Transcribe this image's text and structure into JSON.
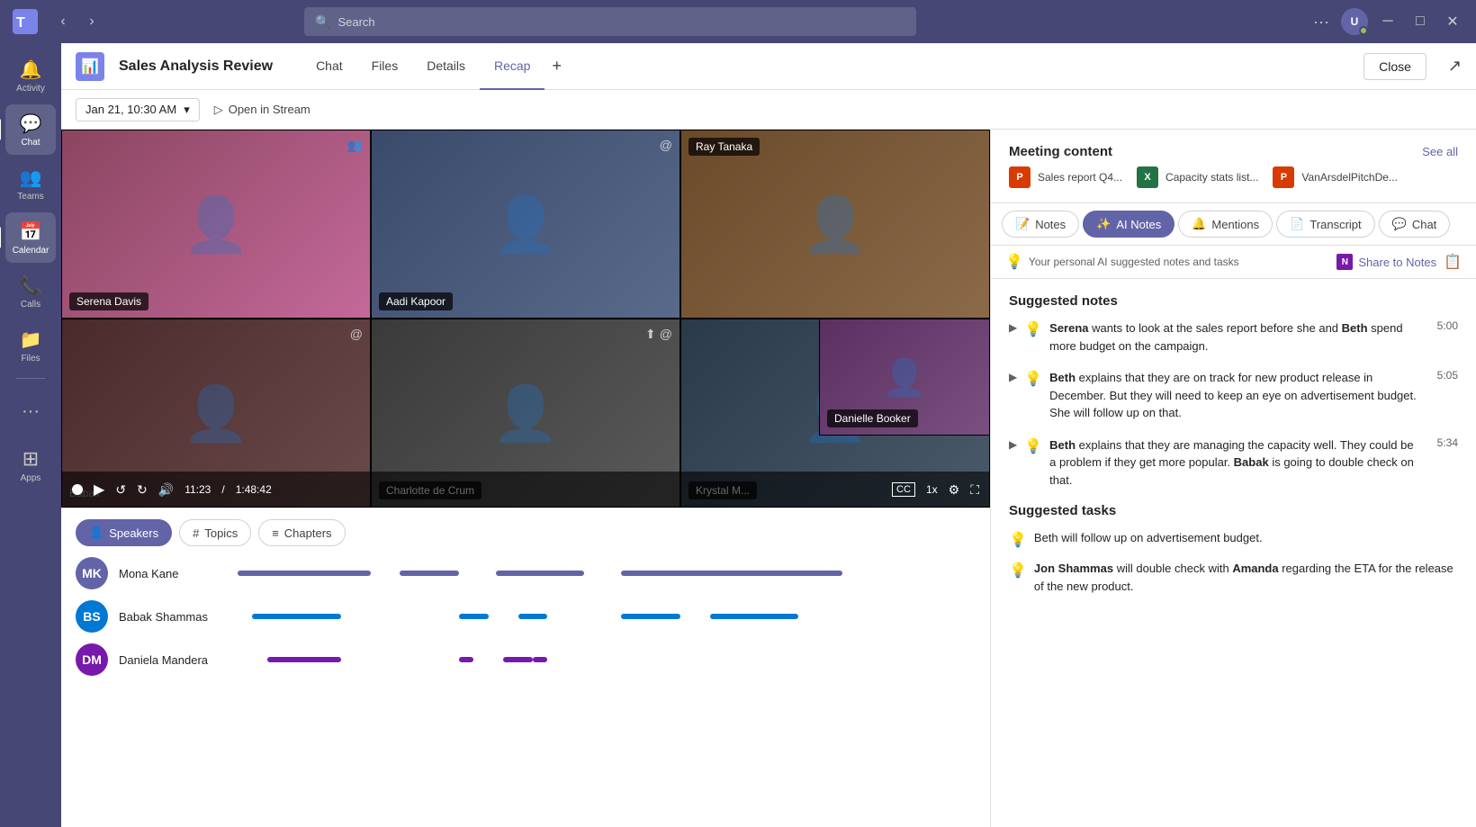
{
  "titlebar": {
    "search_placeholder": "Search",
    "ellipsis": "···",
    "user_initials": "U"
  },
  "sidebar": {
    "items": [
      {
        "id": "activity",
        "label": "Activity",
        "icon": "🔔"
      },
      {
        "id": "chat",
        "label": "Chat",
        "icon": "💬"
      },
      {
        "id": "teams",
        "label": "Teams",
        "icon": "👥"
      },
      {
        "id": "calendar",
        "label": "Calendar",
        "icon": "📅"
      },
      {
        "id": "calls",
        "label": "Calls",
        "icon": "📞"
      },
      {
        "id": "files",
        "label": "Files",
        "icon": "📁"
      },
      {
        "id": "more",
        "label": "···",
        "icon": "···"
      },
      {
        "id": "apps",
        "label": "Apps",
        "icon": "+"
      }
    ]
  },
  "meeting": {
    "title": "Sales Analysis Review",
    "tabs": [
      "Chat",
      "Files",
      "Details",
      "Recap"
    ],
    "active_tab": "Recap",
    "add_tab_label": "+",
    "close_label": "Close",
    "date_time": "Jan 21, 10:30 AM",
    "open_stream_label": "Open in Stream"
  },
  "video": {
    "participants": [
      {
        "name": "Serena Davis",
        "position": "bottom-left"
      },
      {
        "name": "Aadi Kapoor",
        "position": "bottom-left"
      },
      {
        "name": "Ray Tanaka",
        "position": "top-left"
      },
      {
        "name": "Danielle Booker",
        "position": "bottom-left"
      },
      {
        "name": "Charlotte de Crum",
        "position": "bottom-left"
      },
      {
        "name": "Krystal M...",
        "position": "bottom-left"
      }
    ],
    "time_current": "11:23",
    "time_total": "1:48:42",
    "controls": {
      "play": "▶",
      "rewind": "↺",
      "forward": "↻",
      "volume": "🔊"
    }
  },
  "speakers_section": {
    "tabs": [
      "Speakers",
      "Topics",
      "Chapters"
    ],
    "speakers": [
      {
        "name": "Mona Kane",
        "initials": "MK",
        "color": "#6264a7"
      },
      {
        "name": "Babak Shammas",
        "initials": "BS",
        "color": "#0078d4"
      },
      {
        "name": "Daniela Mandera",
        "initials": "DM",
        "color": "#7719aa"
      }
    ]
  },
  "right_panel": {
    "meeting_content_title": "Meeting content",
    "see_all_label": "See all",
    "files": [
      {
        "name": "Sales report Q4...",
        "type": "ppt",
        "icon": "P"
      },
      {
        "name": "Capacity stats list...",
        "type": "xlsx",
        "icon": "X"
      },
      {
        "name": "VanArsdelPitchDe...",
        "type": "ppt",
        "icon": "P"
      }
    ],
    "tabs": [
      {
        "id": "notes",
        "label": "Notes",
        "icon": "📝"
      },
      {
        "id": "ai-notes",
        "label": "AI Notes",
        "icon": "✨",
        "active": true
      },
      {
        "id": "mentions",
        "label": "Mentions",
        "icon": "🔔"
      },
      {
        "id": "transcript",
        "label": "Transcript",
        "icon": "📄"
      },
      {
        "id": "chat",
        "label": "Chat",
        "icon": "💬"
      }
    ],
    "ai_notes_desc": "Your personal AI suggested notes and tasks",
    "share_to_notes_label": "Share to Notes",
    "suggested_notes_title": "Suggested notes",
    "notes": [
      {
        "text_parts": [
          {
            "bold": true,
            "text": "Serena"
          },
          {
            "bold": false,
            "text": " wants to look at the sales report before she and "
          },
          {
            "bold": true,
            "text": "Beth"
          },
          {
            "bold": false,
            "text": " spend more budget on the campaign."
          }
        ],
        "time": "5:00"
      },
      {
        "text_parts": [
          {
            "bold": true,
            "text": "Beth"
          },
          {
            "bold": false,
            "text": " explains that they are on track for new product release in December. But they will need to keep an eye on advertisement budget. She will follow up on that."
          }
        ],
        "time": "5:05"
      },
      {
        "text_parts": [
          {
            "bold": true,
            "text": "Beth"
          },
          {
            "bold": false,
            "text": " explains that they are managing the capacity well. They could be a problem if they get more popular. "
          },
          {
            "bold": true,
            "text": "Babak"
          },
          {
            "bold": false,
            "text": " is going to double check on that."
          }
        ],
        "time": "5:34"
      }
    ],
    "suggested_tasks_title": "Suggested tasks",
    "tasks": [
      {
        "text_parts": [
          {
            "bold": false,
            "text": "Beth will follow up on advertisement budget."
          }
        ]
      },
      {
        "text_parts": [
          {
            "bold": true,
            "text": "Jon Shammas"
          },
          {
            "bold": false,
            "text": " will double check with "
          },
          {
            "bold": true,
            "text": "Amanda"
          },
          {
            "bold": false,
            "text": " regarding the ETA for the release of the new product."
          }
        ]
      }
    ]
  }
}
